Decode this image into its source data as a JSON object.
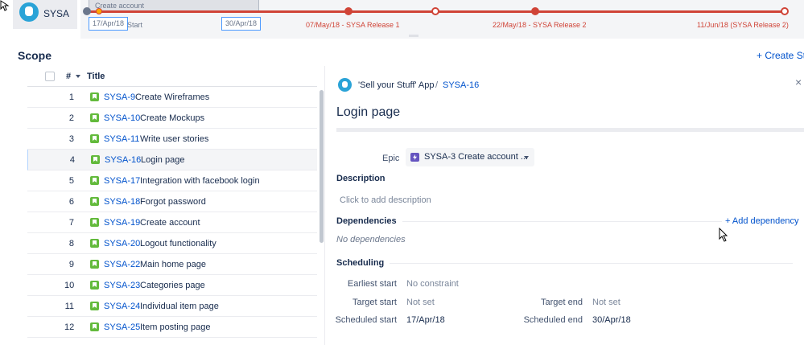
{
  "app": {
    "name": "SYSA"
  },
  "timeline": {
    "selected_bar_label": "Create account",
    "start_date": "17/Apr/18",
    "start_label": "Start",
    "end_date": "30/Apr/18",
    "milestones": [
      {
        "label": "07/May/18 - SYSA Release 1"
      },
      {
        "label": "22/May/18 - SYSA Release 2"
      },
      {
        "label": "11/Jun/18 (SYSA Release 2)"
      }
    ]
  },
  "scope": {
    "title": "Scope",
    "create_story": "+ Create Sto"
  },
  "table": {
    "columns": {
      "number": "#",
      "title": "Title"
    },
    "rows": [
      {
        "num": "1",
        "key": "SYSA-9",
        "title": "Create Wireframes"
      },
      {
        "num": "2",
        "key": "SYSA-10",
        "title": "Create Mockups"
      },
      {
        "num": "3",
        "key": "SYSA-11",
        "title": "Write user stories"
      },
      {
        "num": "4",
        "key": "SYSA-16",
        "title": "Login page"
      },
      {
        "num": "5",
        "key": "SYSA-17",
        "title": "Integration with facebook login"
      },
      {
        "num": "6",
        "key": "SYSA-18",
        "title": "Forgot password"
      },
      {
        "num": "7",
        "key": "SYSA-19",
        "title": "Create account"
      },
      {
        "num": "8",
        "key": "SYSA-20",
        "title": "Logout functionality"
      },
      {
        "num": "9",
        "key": "SYSA-22",
        "title": "Main home page"
      },
      {
        "num": "10",
        "key": "SYSA-23",
        "title": "Categories page"
      },
      {
        "num": "11",
        "key": "SYSA-24",
        "title": "Individual item page"
      },
      {
        "num": "12",
        "key": "SYSA-25",
        "title": "Item posting page"
      }
    ]
  },
  "detail": {
    "project_name": "'Sell your Stuff' App",
    "breadcrumb_sep": "/",
    "issue_key": "SYSA-16",
    "close_glyph": "×",
    "title": "Login page",
    "epic_label": "Epic",
    "epic_value": "SYSA-3 Create account ...",
    "description_heading": "Description",
    "description_placeholder": "Click to add description",
    "dependencies_heading": "Dependencies",
    "add_dependency": "+ Add dependency",
    "no_dependencies": "No dependencies",
    "scheduling_heading": "Scheduling",
    "earliest_start_label": "Earliest start",
    "earliest_start_value": "No constraint",
    "target_start_label": "Target start",
    "target_start_value": "Not set",
    "target_end_label": "Target end",
    "target_end_value": "Not set",
    "scheduled_start_label": "Scheduled start",
    "scheduled_start_value": "17/Apr/18",
    "scheduled_end_label": "Scheduled end",
    "scheduled_end_value": "30/Apr/18"
  },
  "colors": {
    "accent": "#0052cc",
    "timeline_red": "#d04437",
    "story_green": "#63ba3c",
    "epic_purple": "#6554c0"
  }
}
